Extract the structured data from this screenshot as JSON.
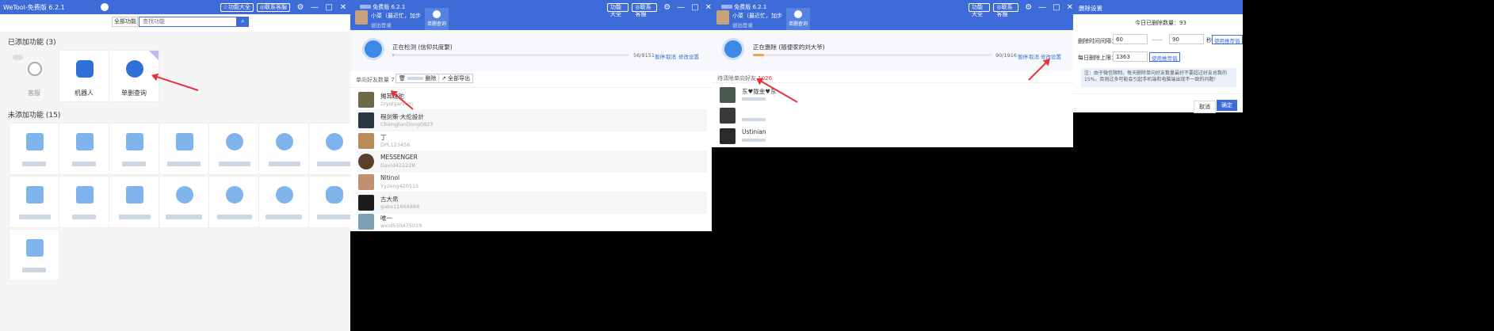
{
  "p1": {
    "app_title": "WeTool-免费版 6.2.1",
    "btn_all": "☆功能大全",
    "btn_contact": "◎联系客服",
    "filter_select": "全部功能",
    "search_placeholder": "查找功能",
    "added_title": "已添加功能 (3)",
    "added": [
      "客服",
      "机器人",
      "单删查询"
    ],
    "unadded_title": "未添加功能 (15)"
  },
  "p2": {
    "title": "免费版 6.2.1",
    "btn_all": "功能大全",
    "btn_contact": "◎联系客服",
    "user_name": "小菜（最近忙，加步",
    "logout": "退出登录",
    "tab_label": "单删查询",
    "status": "正在检测 (信仰共度繁)",
    "progress_text": "56/9151",
    "progress": 0.006,
    "actions": [
      "暂停",
      "取消",
      "修改设置"
    ],
    "friends_count_label": "单向好友数量 7",
    "btn_delete_all": "删除",
    "btn_export_all": "全部导出",
    "friends": [
      {
        "name": "摊耳蹉跎",
        "id": "zzyqiganhen"
      },
      {
        "name": "程剑策·大伦設計",
        "id": "ChengJianDong0823"
      },
      {
        "name": "丁",
        "id": "DPL123456"
      },
      {
        "name": "MESSENGER",
        "id": "David422228"
      },
      {
        "name": "Nitinol",
        "id": "Yyzeng420115"
      },
      {
        "name": "古大帛",
        "id": "gabx11866888"
      },
      {
        "name": "唯一",
        "id": "wxid530475019"
      }
    ]
  },
  "p3": {
    "title": "免费版 6.2.1",
    "btn_all": "功能大全",
    "btn_contact": "◎联系客服",
    "user_name": "小菜（最近忙，加步",
    "logout": "退出登录",
    "tab_label": "单删查询",
    "status": "正在删除 (随便家的刘大爷)",
    "progress_text": "90/1916",
    "progress": 0.047,
    "actions": [
      "暂停",
      "取消",
      "修改设置"
    ],
    "pending_label": "待清除单向好友",
    "pending_count": "1026",
    "friends": [
      {
        "name": "东♥陇金♥东",
        "id": ""
      },
      {
        "name": "",
        "id": ""
      },
      {
        "name": "Ustinian",
        "id": ""
      }
    ]
  },
  "p4": {
    "heading": "删除设置",
    "today_label": "今日已删除数量",
    "today_count": "93",
    "interval_label": "删除时间间隔：",
    "interval_min": "60",
    "interval_dash": "——",
    "interval_max": "90",
    "interval_unit": "秒",
    "btn_recommend": "使用推荐值",
    "daily_label": "每日删除上限：",
    "daily_value": "1363",
    "note": "注：由于微信限制，每天删除单向好友数量最好不要超过好友总数的15%，否则过多可能会引起手机端和电脑端出现不一致的问题！",
    "btn_cancel": "取消",
    "btn_ok": "确定"
  },
  "colors": {
    "accent": "#3d6bd7",
    "red": "#e8323c",
    "progress_green": "#8bd27a",
    "progress_orange": "#f4a154"
  }
}
